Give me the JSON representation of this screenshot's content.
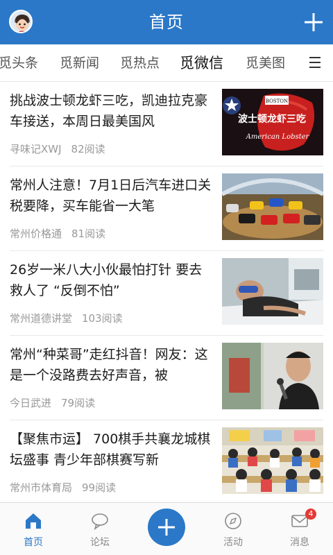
{
  "header": {
    "title": "首页"
  },
  "tabs": [
    {
      "label": "觅头条"
    },
    {
      "label": "觅新闻"
    },
    {
      "label": "觅热点"
    },
    {
      "label": "觅微信"
    },
    {
      "label": "觅美图"
    }
  ],
  "active_tab": "觅微信",
  "news": [
    {
      "title": "挑战波士顿龙虾三吃，凯迪拉克豪车接送，本周日最美国风",
      "source": "寻味记XWJ",
      "reads": "82阅读",
      "thumb_text_top": "BOSTON",
      "thumb_text_main": "波士顿龙虾三吃",
      "thumb_text_script": "American Lobster"
    },
    {
      "title": "常州人注意！7月1日后汽车进口关税要降，买车能省一大笔",
      "source": "常州价格通",
      "reads": "81阅读"
    },
    {
      "title": "26岁一米八大小伙最怕打针 要去救人了 “反倒不怕”",
      "source": "常州道德讲堂",
      "reads": "103阅读"
    },
    {
      "title": "常州“种菜哥”走红抖音！网友：这是一个没路费去好声音，被",
      "source": "今日武进",
      "reads": "79阅读"
    },
    {
      "title": "【聚焦市运】 700棋手共襄龙城棋坛盛事 青少年部棋赛写新",
      "source": "常州市体育局",
      "reads": "99阅读"
    }
  ],
  "bottom_nav": [
    {
      "label": "首页",
      "icon": "home-icon"
    },
    {
      "label": "论坛",
      "icon": "chat-bubble-icon"
    },
    {
      "label": "活动",
      "icon": "compass-icon"
    },
    {
      "label": "消息",
      "icon": "mail-icon",
      "badge": "4"
    }
  ],
  "colors": {
    "brand": "#2b78c8",
    "badge": "#e53935"
  }
}
